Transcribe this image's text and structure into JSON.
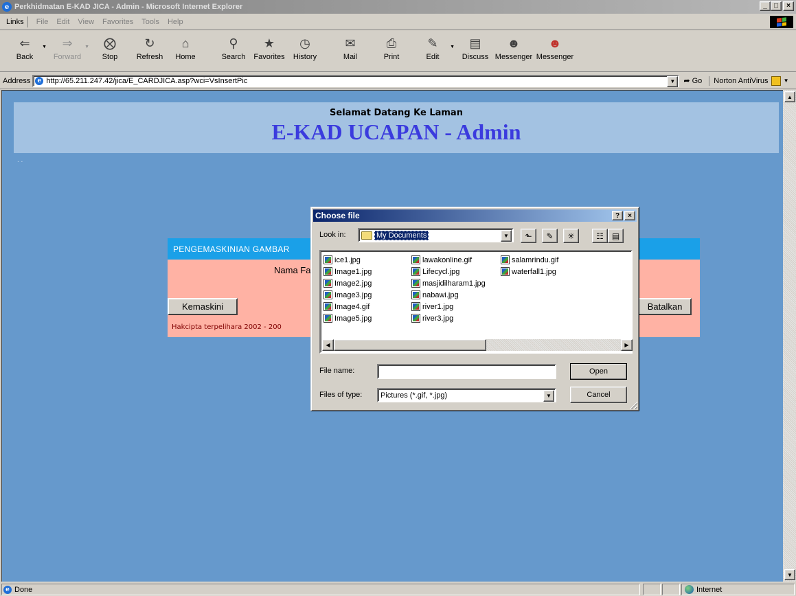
{
  "window": {
    "title": "Perkhidmatan E-KAD JICA - Admin - Microsoft Internet Explorer",
    "controls": [
      "_",
      "□",
      "×"
    ]
  },
  "menubar": {
    "links_label": "Links",
    "items": [
      "File",
      "Edit",
      "View",
      "Favorites",
      "Tools",
      "Help"
    ]
  },
  "toolbar": {
    "buttons": [
      {
        "label": "Back",
        "icon": "back-arrow-icon"
      },
      {
        "label": "Forward",
        "icon": "forward-arrow-icon"
      },
      {
        "label": "Stop",
        "icon": "stop-icon"
      },
      {
        "label": "Refresh",
        "icon": "refresh-icon"
      },
      {
        "label": "Home",
        "icon": "home-icon"
      },
      {
        "label": "Search",
        "icon": "search-icon"
      },
      {
        "label": "Favorites",
        "icon": "favorites-icon"
      },
      {
        "label": "History",
        "icon": "history-icon"
      },
      {
        "label": "Mail",
        "icon": "mail-icon"
      },
      {
        "label": "Print",
        "icon": "print-icon"
      },
      {
        "label": "Edit",
        "icon": "edit-icon"
      },
      {
        "label": "Discuss",
        "icon": "discuss-icon"
      },
      {
        "label": "Messenger",
        "icon": "messenger-icon"
      },
      {
        "label": "Messenger",
        "icon": "messenger-badge-icon"
      }
    ]
  },
  "addressbar": {
    "label": "Address",
    "url": "http://65.211.247.42/jica/E_CARDJICA.asp?wci=VsInsertPic",
    "go_label": "Go",
    "norton_label": "Norton AntiVirus"
  },
  "page": {
    "welcome": "Selamat Datang Ke Laman",
    "heading": "E-KAD UCAPAN - Admin",
    "dots": ". .",
    "form": {
      "header": "PENGEMASKINIAN GAMBAR",
      "field_label": "Nama Fa",
      "update_button": "Kemaskini",
      "cancel_button": "Batalkan",
      "copyright": "Hakcipta terpelihara 2002 - 200"
    }
  },
  "dialog": {
    "title": "Choose file",
    "help_btn": "?",
    "close_btn": "×",
    "look_in_label": "Look in:",
    "look_in_value": "My Documents",
    "files_col1": [
      "ice1.jpg",
      "Image1.jpg",
      "Image2.jpg",
      "Image3.jpg",
      "Image4.gif",
      "Image5.jpg"
    ],
    "files_col2": [
      "lawakonline.gif",
      "Lifecycl.jpg",
      "masjidilharam1.jpg",
      "nabawi.jpg",
      "river1.jpg",
      "river3.jpg"
    ],
    "files_col3": [
      "salamrindu.gif",
      "waterfall1.jpg"
    ],
    "file_name_label": "File name:",
    "file_name_value": "",
    "files_of_type_label": "Files of type:",
    "files_of_type_value": "Pictures (*.gif, *.jpg)",
    "open_button": "Open",
    "cancel_button": "Cancel"
  },
  "statusbar": {
    "status": "Done",
    "zone": "Internet"
  }
}
